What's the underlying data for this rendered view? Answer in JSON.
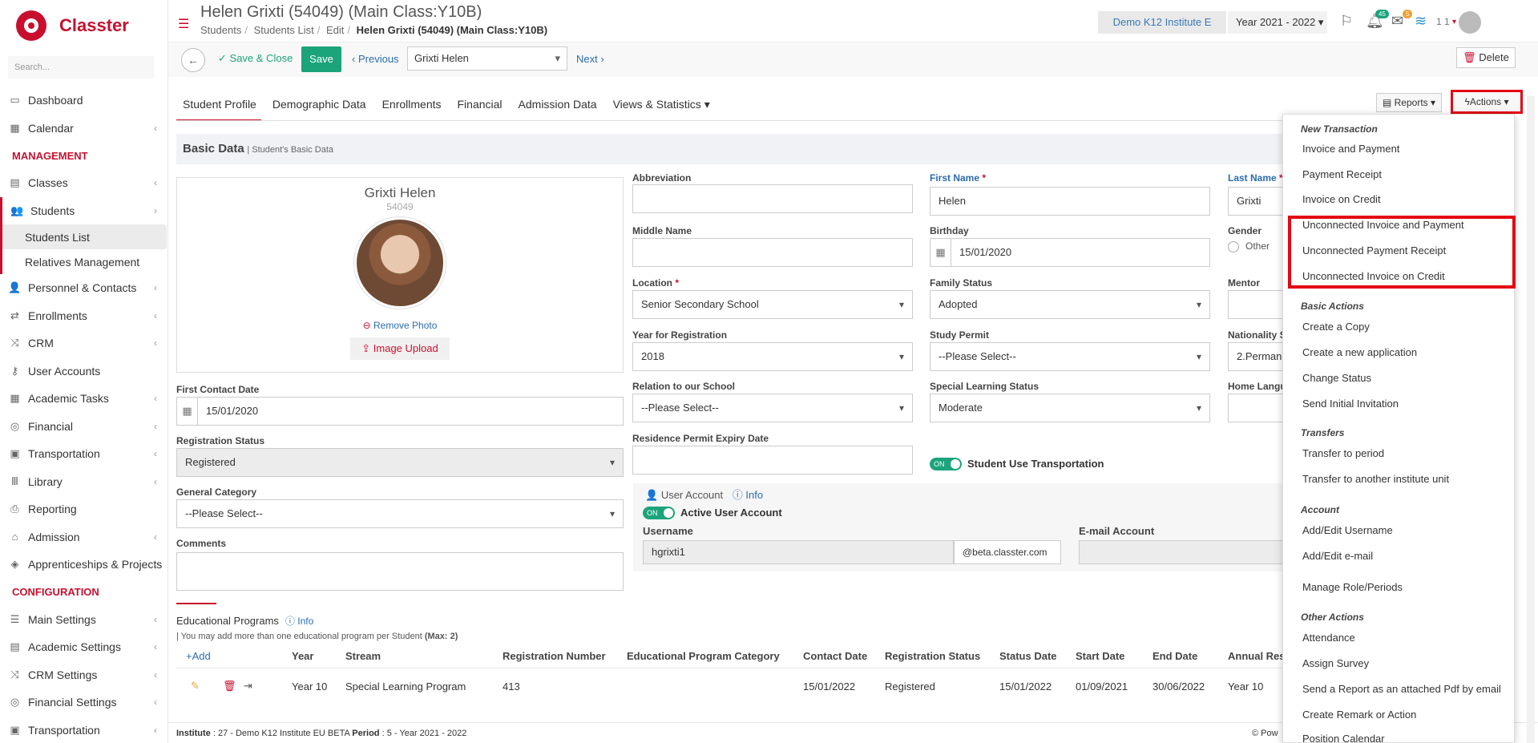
{
  "sidebar": {
    "brand": "Classter",
    "search_placeholder": "Search...",
    "items": [
      {
        "label": "Dashboard",
        "icon": "monitor-icon",
        "chevron": false
      },
      {
        "label": "Calendar",
        "icon": "calendar-icon",
        "chevron": true
      }
    ],
    "section_management": "MANAGEMENT",
    "management": [
      {
        "label": "Classes",
        "icon": "classes-icon"
      },
      {
        "label": "Students",
        "icon": "students-icon"
      }
    ],
    "students_sub": [
      "Students List",
      "Relatives Management"
    ],
    "management_rest": [
      {
        "label": "Personnel & Contacts",
        "icon": "personnel-icon"
      },
      {
        "label": "Enrollments",
        "icon": "enrollments-icon"
      },
      {
        "label": "CRM",
        "icon": "crm-icon"
      },
      {
        "label": "User Accounts",
        "icon": "key-icon"
      },
      {
        "label": "Academic Tasks",
        "icon": "tasks-icon"
      },
      {
        "label": "Financial",
        "icon": "coins-icon"
      },
      {
        "label": "Transportation",
        "icon": "bus-icon"
      },
      {
        "label": "Library",
        "icon": "library-icon"
      },
      {
        "label": "Reporting",
        "icon": "printer-icon"
      },
      {
        "label": "Admission",
        "icon": "building-icon"
      },
      {
        "label": "Apprenticeships & Projects",
        "icon": "cube-icon"
      }
    ],
    "section_configuration": "CONFIGURATION",
    "configuration": [
      {
        "label": "Main Settings",
        "icon": "sliders-icon"
      },
      {
        "label": "Academic Settings",
        "icon": "classes-icon"
      },
      {
        "label": "CRM Settings",
        "icon": "crm-icon"
      },
      {
        "label": "Financial Settings",
        "icon": "coins-icon"
      },
      {
        "label": "Transportation",
        "icon": "bus-icon"
      }
    ]
  },
  "header": {
    "title": "Helen Grixti (54049) (Main Class:Y10B)",
    "breadcrumbs": [
      "Students",
      "Students List",
      "Edit"
    ],
    "breadcrumb_current": "Helen Grixti (54049) (Main Class:Y10B)",
    "institute": "Demo K12 Institute E",
    "year": "Year 2021 - 2022",
    "notif_count": "45",
    "mail_count": "5",
    "user_num": "1 1"
  },
  "toolbar": {
    "save_close": "Save & Close",
    "save": "Save",
    "previous": "Previous",
    "student_select": "Grixti Helen",
    "next": "Next",
    "delete": "Delete"
  },
  "tabs": [
    "Student Profile",
    "Demographic Data",
    "Enrollments",
    "Financial",
    "Admission Data",
    "Views & Statistics"
  ],
  "reports_label": "Reports",
  "actions_label": "Actions",
  "basic": {
    "title": "Basic Data",
    "subtitle": "Student's Basic Data"
  },
  "profile": {
    "name": "Grixti Helen",
    "id": "54049",
    "remove_photo": "Remove Photo",
    "upload": "Image Upload"
  },
  "form": {
    "abbreviation_label": "Abbreviation",
    "first_name_label": "First Name",
    "first_name_value": "Helen",
    "last_name_label": "Last Name",
    "last_name_value": "Grixti",
    "middle_name_label": "Middle Name",
    "birthday_label": "Birthday",
    "birthday_value": "15/01/2020",
    "gender_label": "Gender",
    "gender_other": "Other",
    "location_label": "Location",
    "location_value": "Senior Secondary School",
    "family_status_label": "Family Status",
    "family_status_value": "Adopted",
    "mentor_label": "Mentor",
    "year_reg_label": "Year for Registration",
    "year_reg_value": "2018",
    "study_permit_label": "Study Permit",
    "study_permit_value": "--Please Select--",
    "nationality_label": "Nationality S",
    "nationality_value": "2.Permane",
    "first_contact_label": "First Contact Date",
    "first_contact_value": "15/01/2020",
    "relation_label": "Relation to our School",
    "relation_value": "--Please Select--",
    "special_learning_label": "Special Learning Status",
    "special_learning_value": "Moderate",
    "home_lang_label": "Home Langu",
    "reg_status_label": "Registration Status",
    "reg_status_value": "Registered",
    "residence_label": "Residence Permit Expiry Date",
    "transport_toggle": "ON",
    "transport_label": "Student Use Transportation",
    "general_cat_label": "General Category",
    "general_cat_value": "--Please Select--",
    "user_account_label": "User Account",
    "info": "Info",
    "active_toggle": "ON",
    "active_label": "Active User Account",
    "username_label": "Username",
    "username_value": "hgrixti1",
    "username_domain": "@beta.classter.com",
    "email_label": "E-mail Account",
    "comments_label": "Comments"
  },
  "edu": {
    "title": "Educational Programs",
    "info": "Info",
    "note": "| You may add more than one educational program per Student",
    "note_max": "(Max: 2)",
    "add": "Add",
    "columns": [
      "Year",
      "Stream",
      "Registration Number",
      "Educational Program Category",
      "Contact Date",
      "Registration Status",
      "Status Date",
      "Start Date",
      "End Date",
      "Annual Resu"
    ],
    "rows": [
      [
        "Year 10",
        "Special Learning Program",
        "413",
        "",
        "15/01/2022",
        "Registered",
        "15/01/2022",
        "01/09/2021",
        "30/06/2022",
        "Year 10"
      ]
    ]
  },
  "footer": {
    "institute_label": "Institute",
    "institute_value": ": 27 - Demo K12 Institute EU BETA",
    "period_label": "Period",
    "period_value": ": 5 - Year 2021 - 2022",
    "right": "Pow"
  },
  "dropdown": {
    "new_transaction": "New Transaction",
    "nt_items": [
      "Invoice and Payment",
      "Payment Receipt",
      "Invoice on Credit",
      "Unconnected Invoice and Payment",
      "Unconnected Payment Receipt",
      "Unconnected Invoice on Credit"
    ],
    "basic_actions": "Basic Actions",
    "ba_items": [
      "Create a Copy",
      "Create a new application",
      "Change Status",
      "Send Initial Invitation"
    ],
    "transfers": "Transfers",
    "tr_items": [
      "Transfer to period",
      "Transfer to another institute unit"
    ],
    "account": "Account",
    "ac_items": [
      "Add/Edit Username",
      "Add/Edit e-mail",
      "Manage Role/Periods"
    ],
    "other_actions": "Other Actions",
    "oa_items": [
      "Attendance",
      "Assign Survey",
      "Send a Report as an attached Pdf by email",
      "Create Remark or Action",
      "Position Calendar"
    ]
  }
}
